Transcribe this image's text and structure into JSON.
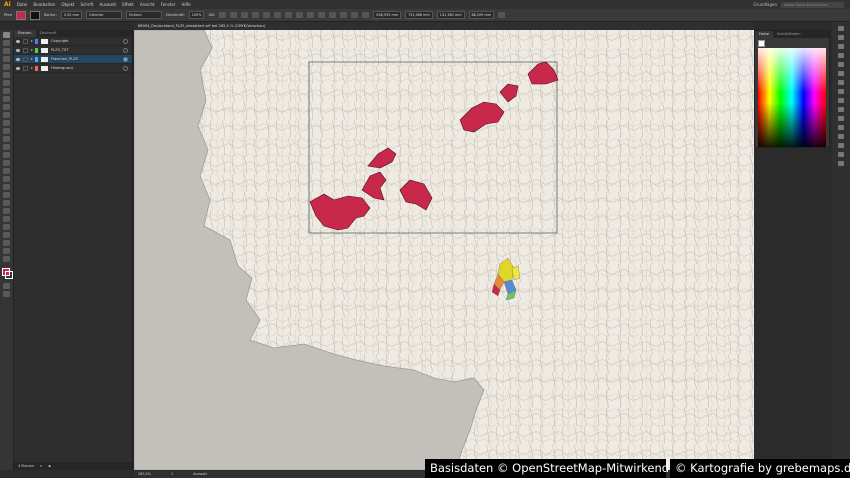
{
  "app": {
    "logo": "Ai"
  },
  "menu": [
    "Datei",
    "Bearbeiten",
    "Objekt",
    "Schrift",
    "Auswahl",
    "Effekt",
    "Ansicht",
    "Fenster",
    "Hilfe"
  ],
  "workspace": "Grundlagen",
  "search_placeholder": "Adobe Stock durchsuchen",
  "control": {
    "object_type": "Pfad",
    "stroke_label": "Kontur:",
    "stroke_value": "0,05 mm",
    "profile": "Gleichm.",
    "brush": "Einfach",
    "opacity_label": "Deckkraft:",
    "opacity_value": "100%",
    "style_label": "Stil:",
    "x": "636,555 mm",
    "y": "731,466 mm",
    "w": "131,362 mm",
    "h": "88,209 mm",
    "fill_color": "#c8294a"
  },
  "document_tab": "68094_Deutschland_PLZ5_ebstahlert.ai* bei 285,5 % (CMYK/Vorschau)",
  "layers_panel": {
    "tabs": [
      "Ebenen",
      "Zeichenfl."
    ],
    "layers": [
      {
        "name": "Copyright",
        "color": "#4f7cff",
        "selected": false
      },
      {
        "name": "PLZ5_TXT",
        "color": "#4fcf4f",
        "selected": false
      },
      {
        "name": "Flaechen_PLZ5",
        "color": "#4fa8ff",
        "selected": true
      },
      {
        "name": "Hintergrund",
        "color": "#ff6060",
        "selected": false
      }
    ],
    "footer": "4 Ebenen"
  },
  "color_panel": {
    "tabs": [
      "Farbe",
      "Farbleitfaden"
    ]
  },
  "status": {
    "zoom": "285,5%",
    "page": "1",
    "mode": "Auswahl"
  },
  "credits": {
    "left": "Basisdaten © OpenStreetMap-Mitwirkende",
    "right": "© Kartografie by grebemaps.de"
  },
  "map": {
    "land_color": "#efebe3",
    "foreign_color": "#c3c0bc",
    "highlight_color": "#c8294a",
    "selection_stroke": "#333333"
  }
}
